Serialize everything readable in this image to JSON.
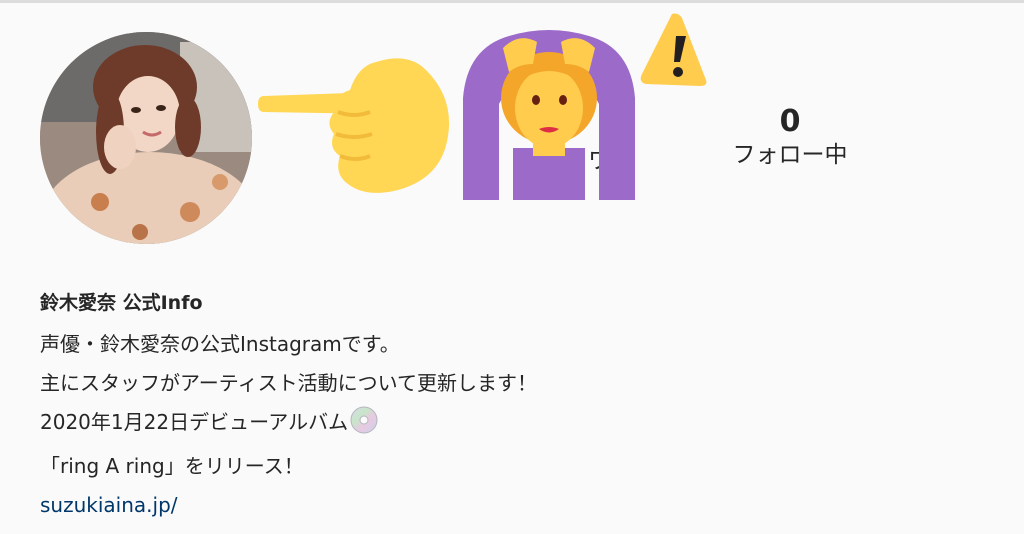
{
  "profile": {
    "name": "鈴木愛奈 公式Info",
    "stats": {
      "followers_label_partial": "ワー",
      "following_count": "0",
      "following_label": "フォロー中"
    },
    "bio_lines": [
      "声優・鈴木愛奈の公式Instagramです。",
      "主にスタッフがアーティスト活動について更新します！",
      "2020年1月22日デビューアルバム",
      "「ring A ring」をリリース！"
    ],
    "website": "suzukiaina.jp/"
  },
  "stickers": [
    "pointing-hand-emoji",
    "woman-gesturing-ok-emoji",
    "warning-emoji"
  ],
  "inline_icons": [
    "optical-disc-emoji"
  ],
  "colors": {
    "background": "#fafafa",
    "text": "#262626",
    "link": "#00376b",
    "emoji_yellow": "#ffd755",
    "emoji_purple": "#9c6bc9",
    "hair_orange": "#f4a62a"
  }
}
